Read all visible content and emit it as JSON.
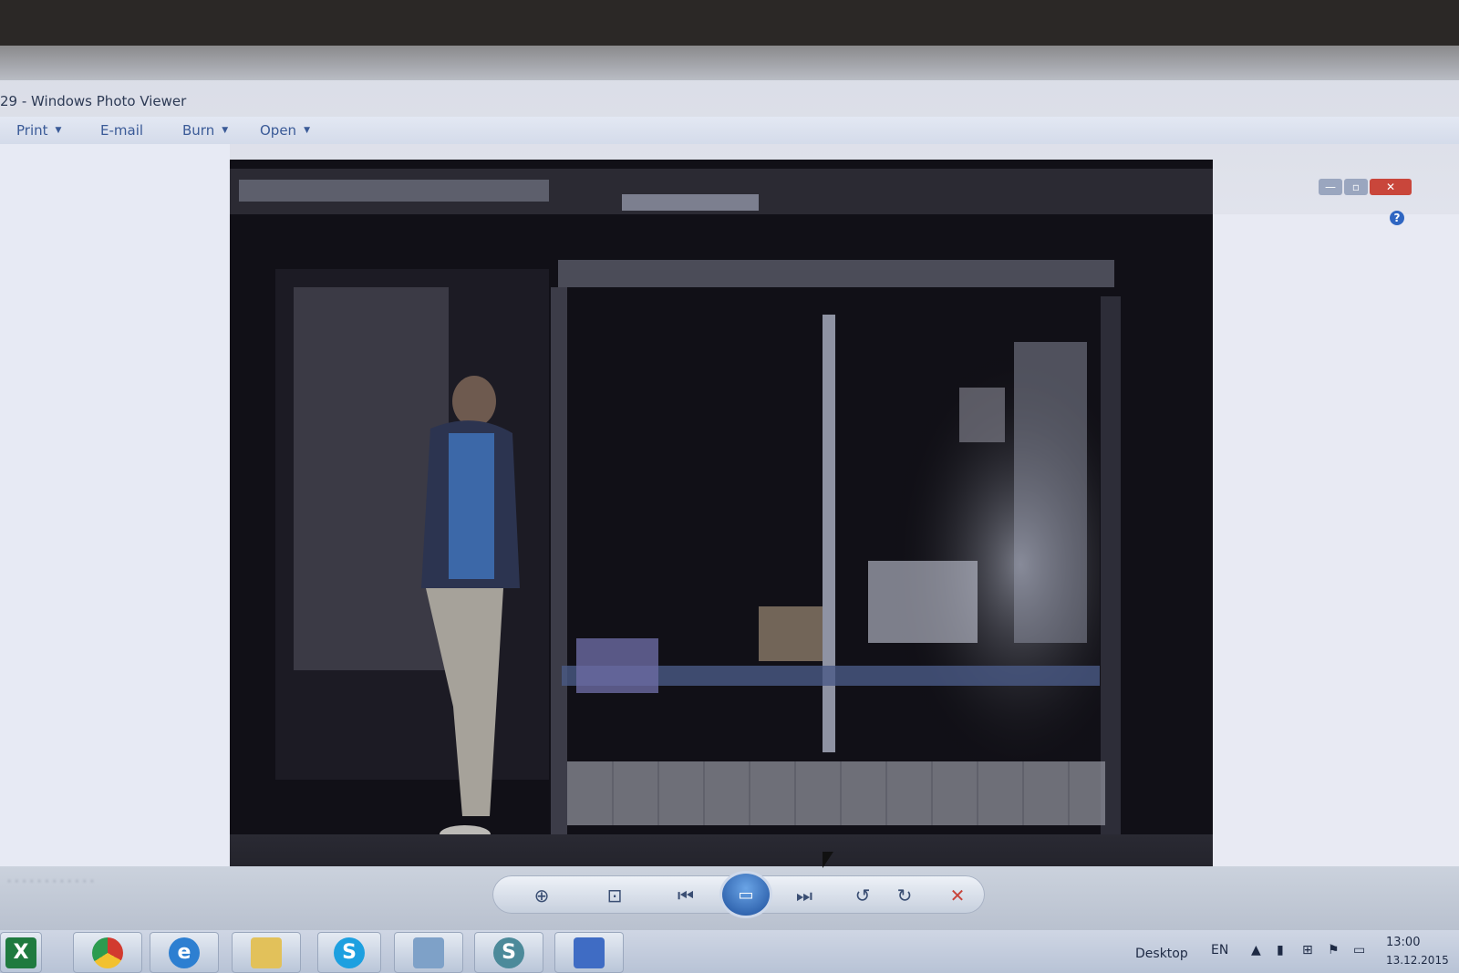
{
  "window": {
    "title": "29 - Windows Photo Viewer"
  },
  "menu": [
    {
      "label": "Print",
      "has_dropdown": true
    },
    {
      "label": "E-mail",
      "has_dropdown": false
    },
    {
      "label": "Burn",
      "has_dropdown": true
    },
    {
      "label": "Open",
      "has_dropdown": true
    }
  ],
  "window_controls": {
    "minimize": "—",
    "maximize": "▫",
    "close": "✕"
  },
  "help_icon": "?",
  "controls": {
    "zoom": "zoom-icon",
    "fit": "actual-size-icon",
    "previous": "previous-icon",
    "slideshow": "slideshow-icon",
    "next": "next-icon",
    "rotate_left": "rotate-counterclockwise-icon",
    "rotate_right": "rotate-clockwise-icon",
    "delete": "delete-icon"
  },
  "taskbar": {
    "apps": [
      "excel-icon",
      "chrome-icon",
      "ie-icon",
      "explorer-icon",
      "skype-icon",
      "photo-viewer-icon",
      "snagit-icon",
      "network-icon"
    ],
    "desktop_label": "Desktop",
    "language": "EN",
    "time": "13:00",
    "date": "13.12.2015"
  },
  "colors": {
    "accent": "#3a5a97",
    "close_red": "#c9463b",
    "slideshow_blue": "#1d4f9c"
  }
}
